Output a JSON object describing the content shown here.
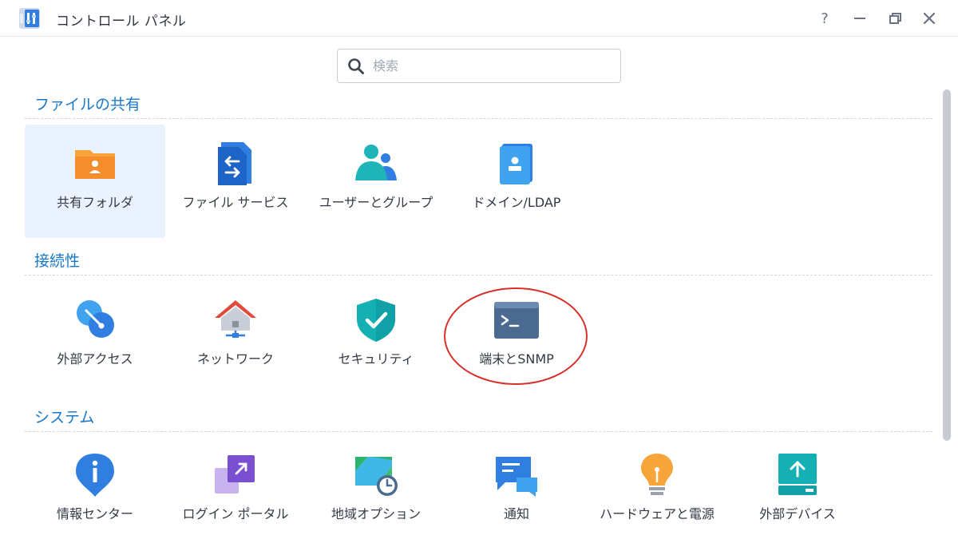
{
  "window": {
    "title": "コントロール パネル",
    "app_icon": "control-panel-icon",
    "controls": [
      "help-icon",
      "minimize-icon",
      "restore-icon",
      "close-icon"
    ],
    "help_label": "?"
  },
  "search": {
    "placeholder": "検索",
    "value": ""
  },
  "sections": [
    {
      "title": "ファイルの共有",
      "items": [
        {
          "label": "共有フォルダ",
          "icon": "shared-folder-icon",
          "selected": true
        },
        {
          "label": "ファイル サービス",
          "icon": "file-services-icon"
        },
        {
          "label": "ユーザーとグループ",
          "icon": "users-groups-icon"
        },
        {
          "label": "ドメイン/LDAP",
          "icon": "domain-ldap-icon"
        }
      ]
    },
    {
      "title": "接続性",
      "items": [
        {
          "label": "外部アクセス",
          "icon": "external-access-icon"
        },
        {
          "label": "ネットワーク",
          "icon": "network-icon"
        },
        {
          "label": "セキュリティ",
          "icon": "security-icon"
        },
        {
          "label": "端末とSNMP",
          "icon": "terminal-icon",
          "annotated": true
        }
      ]
    },
    {
      "title": "システム",
      "items": [
        {
          "label": "情報センター",
          "icon": "info-center-icon"
        },
        {
          "label": "ログイン ポータル",
          "icon": "login-portal-icon"
        },
        {
          "label": "地域オプション",
          "icon": "regional-options-icon"
        },
        {
          "label": "通知",
          "icon": "notification-icon"
        },
        {
          "label": "ハードウェアと電源",
          "icon": "hardware-power-icon"
        },
        {
          "label": "外部デバイス",
          "icon": "external-devices-icon"
        }
      ]
    }
  ],
  "colors": {
    "accent": "#1a78c9",
    "selected_bg": "#e9f2fd",
    "annotation": "#d7302a"
  }
}
